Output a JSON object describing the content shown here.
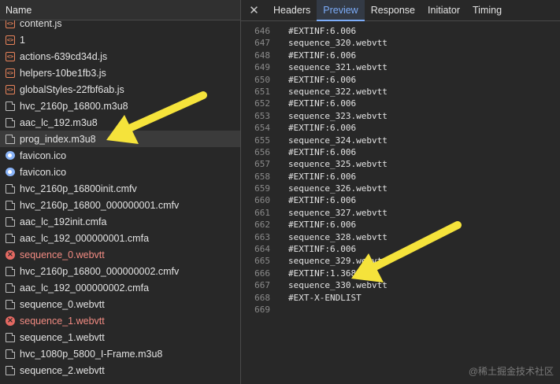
{
  "network_list": {
    "header": "Name",
    "rows": [
      {
        "name": "content.js",
        "icon": "script",
        "status": "normal"
      },
      {
        "name": "1",
        "icon": "script",
        "status": "normal"
      },
      {
        "name": "actions-639cd34d.js",
        "icon": "script",
        "status": "normal"
      },
      {
        "name": "helpers-10be1fb3.js",
        "icon": "script",
        "status": "normal"
      },
      {
        "name": "globalStyles-22fbf6ab.js",
        "icon": "script",
        "status": "normal"
      },
      {
        "name": "hvc_2160p_16800.m3u8",
        "icon": "doc",
        "status": "normal"
      },
      {
        "name": "aac_lc_192.m3u8",
        "icon": "doc",
        "status": "normal"
      },
      {
        "name": "prog_index.m3u8",
        "icon": "doc",
        "status": "selected"
      },
      {
        "name": "favicon.ico",
        "icon": "image",
        "status": "normal"
      },
      {
        "name": "favicon.ico",
        "icon": "image",
        "status": "normal"
      },
      {
        "name": "hvc_2160p_16800init.cmfv",
        "icon": "doc",
        "status": "normal"
      },
      {
        "name": "hvc_2160p_16800_000000001.cmfv",
        "icon": "doc",
        "status": "normal"
      },
      {
        "name": "aac_lc_192init.cmfa",
        "icon": "doc",
        "status": "normal"
      },
      {
        "name": "aac_lc_192_000000001.cmfa",
        "icon": "doc",
        "status": "normal"
      },
      {
        "name": "sequence_0.webvtt",
        "icon": "error",
        "status": "error"
      },
      {
        "name": "hvc_2160p_16800_000000002.cmfv",
        "icon": "doc",
        "status": "normal"
      },
      {
        "name": "aac_lc_192_000000002.cmfa",
        "icon": "doc",
        "status": "normal"
      },
      {
        "name": "sequence_0.webvtt",
        "icon": "doc",
        "status": "normal"
      },
      {
        "name": "sequence_1.webvtt",
        "icon": "error",
        "status": "error"
      },
      {
        "name": "sequence_1.webvtt",
        "icon": "doc",
        "status": "normal"
      },
      {
        "name": "hvc_1080p_5800_I-Frame.m3u8",
        "icon": "doc",
        "status": "normal"
      },
      {
        "name": "sequence_2.webvtt",
        "icon": "doc",
        "status": "normal"
      }
    ]
  },
  "detail_panel": {
    "close_label": "✕",
    "tabs": [
      {
        "label": "Headers",
        "active": false
      },
      {
        "label": "Preview",
        "active": true
      },
      {
        "label": "Response",
        "active": false
      },
      {
        "label": "Initiator",
        "active": false
      },
      {
        "label": "Timing",
        "active": false
      }
    ],
    "lines": [
      {
        "n": "646",
        "text": "#EXTINF:6.006"
      },
      {
        "n": "647",
        "text": "sequence_320.webvtt"
      },
      {
        "n": "648",
        "text": "#EXTINF:6.006"
      },
      {
        "n": "649",
        "text": "sequence_321.webvtt"
      },
      {
        "n": "650",
        "text": "#EXTINF:6.006"
      },
      {
        "n": "651",
        "text": "sequence_322.webvtt"
      },
      {
        "n": "652",
        "text": "#EXTINF:6.006"
      },
      {
        "n": "653",
        "text": "sequence_323.webvtt"
      },
      {
        "n": "654",
        "text": "#EXTINF:6.006"
      },
      {
        "n": "655",
        "text": "sequence_324.webvtt"
      },
      {
        "n": "656",
        "text": "#EXTINF:6.006"
      },
      {
        "n": "657",
        "text": "sequence_325.webvtt"
      },
      {
        "n": "658",
        "text": "#EXTINF:6.006"
      },
      {
        "n": "659",
        "text": "sequence_326.webvtt"
      },
      {
        "n": "660",
        "text": "#EXTINF:6.006"
      },
      {
        "n": "661",
        "text": "sequence_327.webvtt"
      },
      {
        "n": "662",
        "text": "#EXTINF:6.006"
      },
      {
        "n": "663",
        "text": "sequence_328.webvtt"
      },
      {
        "n": "664",
        "text": "#EXTINF:6.006"
      },
      {
        "n": "665",
        "text": "sequence_329.webvtt"
      },
      {
        "n": "666",
        "text": "#EXTINF:1.368"
      },
      {
        "n": "667",
        "text": "sequence_330.webvtt"
      },
      {
        "n": "668",
        "text": "#EXT-X-ENDLIST"
      },
      {
        "n": "669",
        "text": ""
      }
    ]
  },
  "annotation_color": "#f5e33b",
  "watermark": "@稀土掘金技术社区"
}
